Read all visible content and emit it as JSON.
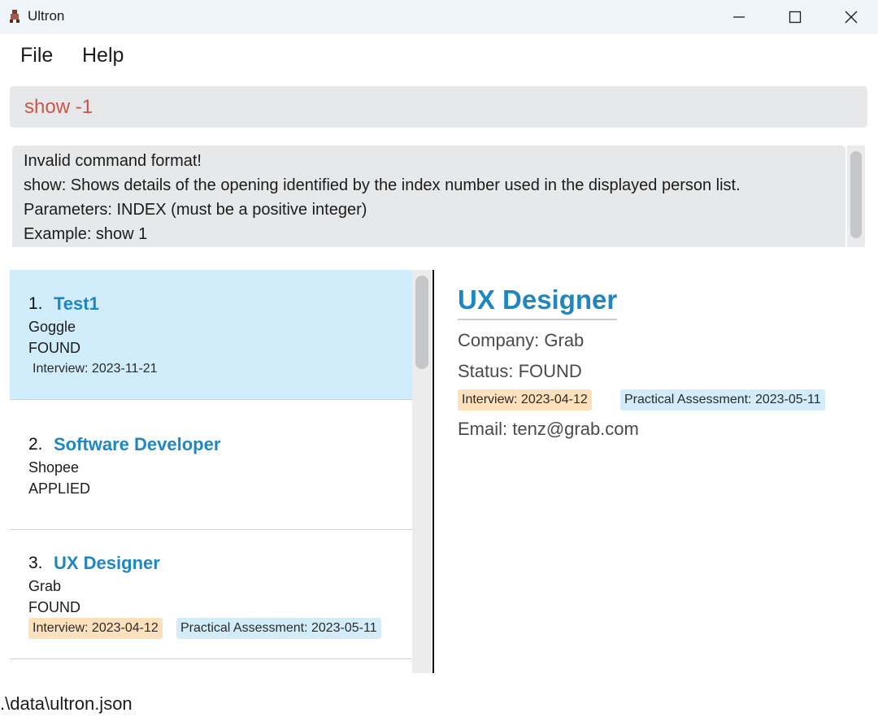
{
  "window": {
    "title": "Ultron",
    "app_icon": "ultron-app-icon",
    "controls": [
      "minimize-icon",
      "maximize-icon",
      "close-icon"
    ]
  },
  "menu": {
    "file": "File",
    "help": "Help"
  },
  "command": {
    "value": "show -1",
    "error_color": "#c9564a"
  },
  "result": {
    "lines": [
      "Invalid command format!",
      "show: Shows details of the opening identified by the index number used in the displayed person list.",
      "Parameters: INDEX (must be a positive integer)",
      "Example: show 1"
    ]
  },
  "list": {
    "cards": [
      {
        "index": "1.",
        "title": "Test1",
        "company": "Goggle",
        "status": "FOUND",
        "tags": [
          "Interview: 2023-11-21"
        ],
        "selected": true
      },
      {
        "index": "2.",
        "title": "Software Developer",
        "company": "Shopee",
        "status": "APPLIED",
        "tags": []
      },
      {
        "index": "3.",
        "title": "UX Designer",
        "company": "Grab",
        "status": "FOUND",
        "tags": [
          "Interview: 2023-04-12",
          "Practical Assessment: 2023-05-11"
        ]
      }
    ]
  },
  "detail": {
    "title": "UX Designer",
    "company": "Company: Grab",
    "status": "Status: FOUND",
    "tags": [
      "Interview: 2023-04-12",
      "Practical Assessment: 2023-05-11"
    ],
    "email": "Email: tenz@grab.com"
  },
  "footer": {
    "path": ".\\data\\ultron.json"
  },
  "colors": {
    "accent_title": "#1e87c3",
    "selected_card": "#d1ecfa",
    "interview_tag": "#fde1bd",
    "practical_tag": "#d3ecfa"
  }
}
